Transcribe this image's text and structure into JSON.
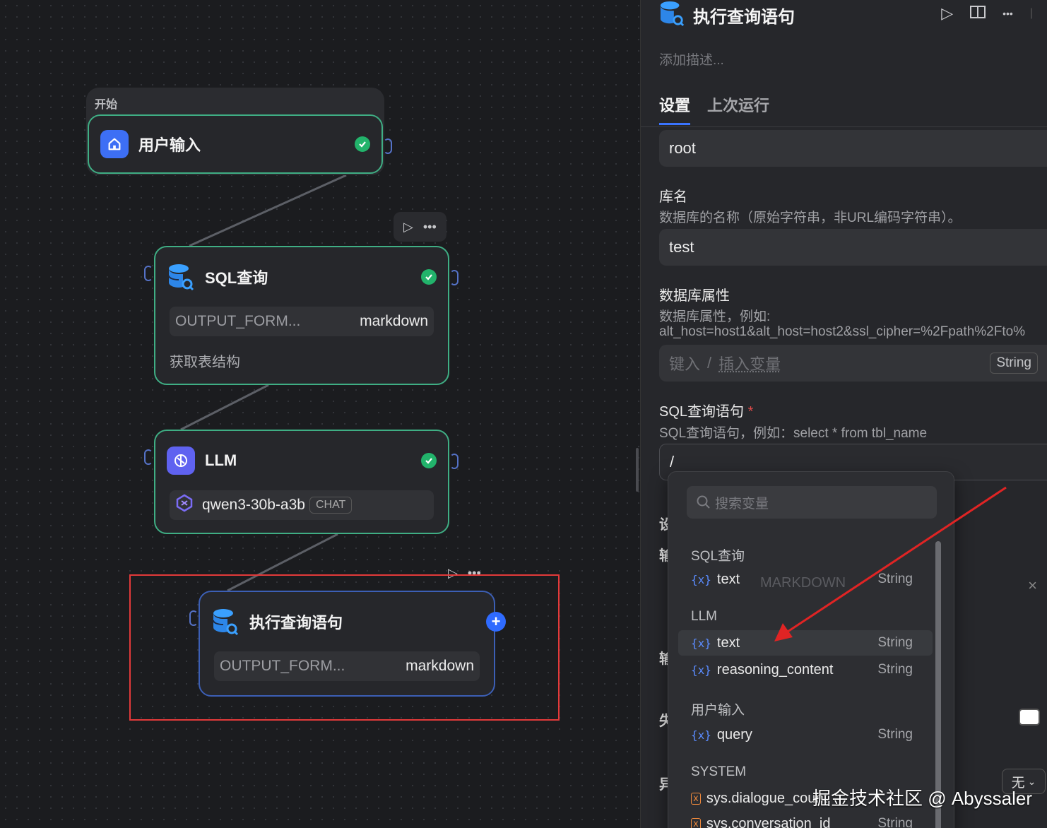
{
  "canvas": {
    "start_group_label": "开始",
    "nodes": {
      "user_input": {
        "title": "用户输入"
      },
      "sql_query": {
        "title": "SQL查询",
        "param_key": "OUTPUT_FORM...",
        "param_value": "markdown",
        "note": "获取表结构"
      },
      "llm": {
        "title": "LLM",
        "model": "qwen3-30b-a3b",
        "model_tag": "CHAT"
      },
      "exec_query": {
        "title": "执行查询语句",
        "param_key": "OUTPUT_FORM...",
        "param_value": "markdown"
      }
    }
  },
  "panel": {
    "title": "执行查询语句",
    "description_placeholder": "添加描述...",
    "tabs": [
      "设置",
      "上次运行"
    ],
    "user_field_value": "root",
    "db_name_label": "库名",
    "db_name_hint": "数据库的名称（原始字符串，非URL编码字符串）。",
    "db_name_value": "test",
    "db_props_label": "数据库属性",
    "db_props_hint_1": "数据库属性，例如:",
    "db_props_hint_2": "alt_host=host1&alt_host=host2&ssl_cipher=%2Fpath%2Fto%",
    "db_props_placeholder_1": "键入",
    "db_props_placeholder_sep": "/",
    "db_props_placeholder_2": "插入变量",
    "db_props_type": "String",
    "sql_label": "SQL查询语句",
    "sql_required": "*",
    "sql_hint": "SQL查询语句，例如：select * from tbl_name",
    "sql_value": "/",
    "behind_labels": [
      "设",
      "输",
      "输",
      "失",
      "异"
    ],
    "behind_markdown": "MARKDOWN",
    "none_select": "无"
  },
  "dropdown": {
    "search_placeholder": "搜索变量",
    "groups": [
      {
        "name": "SQL查询",
        "items": [
          {
            "name": "text",
            "type": "String"
          }
        ]
      },
      {
        "name": "LLM",
        "items": [
          {
            "name": "text",
            "type": "String"
          },
          {
            "name": "reasoning_content",
            "type": "String"
          }
        ]
      },
      {
        "name": "用户输入",
        "items": [
          {
            "name": "query",
            "type": "String"
          }
        ]
      },
      {
        "name": "SYSTEM",
        "items": [
          {
            "name": "sys.dialogue_count",
            "type": ""
          },
          {
            "name": "sys.conversation_id",
            "type": "String"
          }
        ]
      }
    ]
  },
  "watermark": "掘金技术社区 @ Abyssaler",
  "colors": {
    "accent": "#3a74ff",
    "success": "#22b36b",
    "node_border": "#3fae84",
    "highlight": "#e33a3a"
  }
}
